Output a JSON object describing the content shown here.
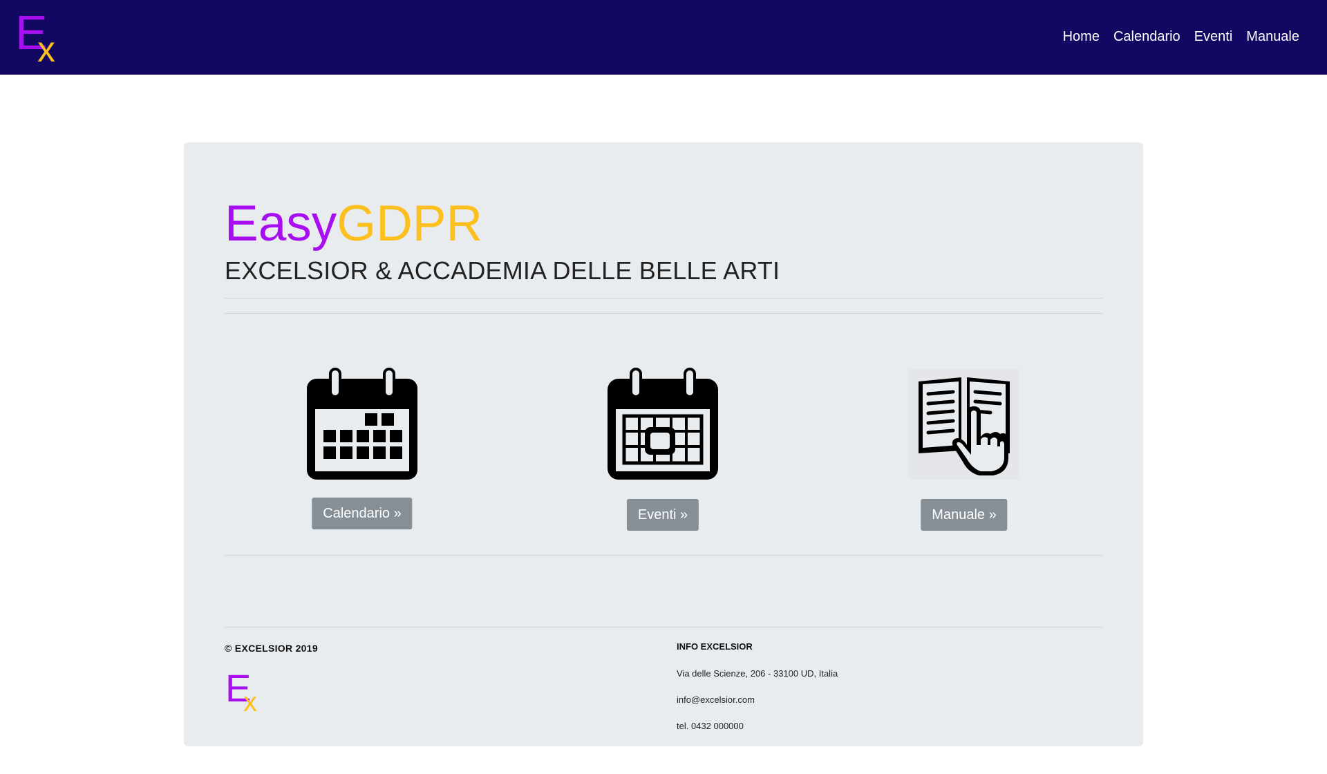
{
  "logo": {
    "letter_e": "E",
    "letter_x": "x"
  },
  "nav": {
    "items": [
      {
        "label": "Home"
      },
      {
        "label": "Calendario"
      },
      {
        "label": "Eventi"
      },
      {
        "label": "Manuale"
      }
    ]
  },
  "hero": {
    "title_part1": "Easy",
    "title_part2": "GDPR",
    "subtitle": "EXCELSIOR & ACCADEMIA DELLE BELLE ARTI"
  },
  "cards": [
    {
      "icon": "calendar-icon",
      "button": "Calendario »"
    },
    {
      "icon": "events-calendar-icon",
      "button": "Eventi »"
    },
    {
      "icon": "manual-book-icon",
      "button": "Manuale »"
    }
  ],
  "footer": {
    "copyright": "© EXCELSIOR 2019",
    "info_title": "INFO EXCELSIOR",
    "address": "Via delle Scienze, 206 - 33100 UD, Italia",
    "email": "info@excelsior.com",
    "phone": "tel. 0432 000000"
  },
  "colors": {
    "navbar": "#120862",
    "purple": "#a80ff0",
    "gold": "#fbbf1f",
    "button": "#868e96",
    "jumbotron": "#e9ecef"
  }
}
